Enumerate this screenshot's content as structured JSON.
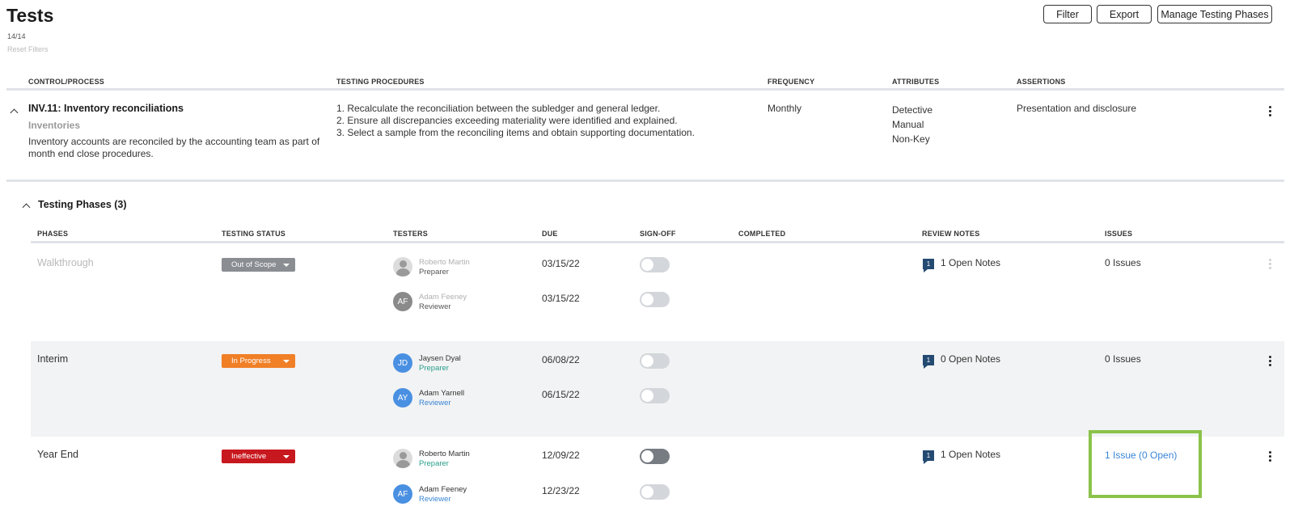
{
  "header": {
    "title": "Tests",
    "count": "14/14",
    "reset_filters": "Reset Filters",
    "buttons": {
      "filter": "Filter",
      "export": "Export",
      "manage": "Manage Testing Phases"
    }
  },
  "control_table": {
    "columns": [
      "CONTROL/PROCESS",
      "TESTING PROCEDURES",
      "FREQUENCY",
      "ATTRIBUTES",
      "ASSERTIONS"
    ],
    "control": {
      "title": "INV.11: Inventory reconciliations",
      "process": "Inventories",
      "description": "Inventory accounts are reconciled by the accounting team as part of month end close procedures.",
      "procedures": [
        "1. Recalculate the reconciliation between the subledger and general ledger.",
        "2. Ensure all discrepancies exceeding materiality were identified and explained.",
        "3. Select a sample from the reconciling items and obtain supporting documentation."
      ],
      "frequency": "Monthly",
      "attributes": [
        "Detective",
        "Manual",
        "Non-Key"
      ],
      "assertions": "Presentation and disclosure"
    }
  },
  "phases": {
    "title": "Testing Phases (3)",
    "columns": [
      "PHASES",
      "TESTING STATUS",
      "TESTERS",
      "DUE",
      "SIGN-OFF",
      "COMPLETED",
      "REVIEW NOTES",
      "ISSUES"
    ],
    "rows": [
      {
        "name": "Walkthrough",
        "status": "Out of Scope",
        "status_color": "#8a8d91",
        "testers": [
          {
            "initials": "",
            "name": "Roberto Martin",
            "role": "Preparer",
            "due": "03/15/22",
            "signed": false
          },
          {
            "initials": "AF",
            "name": "Adam Feeney",
            "role": "Reviewer",
            "due": "03/15/22",
            "signed": false
          }
        ],
        "notes_count": "1",
        "notes": "1 Open Notes",
        "issues": "0 Issues"
      },
      {
        "name": "Interim",
        "status": "In Progress",
        "status_color": "#f07f26",
        "testers": [
          {
            "initials": "JD",
            "name": "Jaysen Dyal",
            "role": "Preparer",
            "due": "06/08/22",
            "signed": false
          },
          {
            "initials": "AY",
            "name": "Adam Yarnell",
            "role": "Reviewer",
            "due": "06/15/22",
            "signed": false
          }
        ],
        "notes_count": "1",
        "notes": "0 Open Notes",
        "issues": "0 Issues"
      },
      {
        "name": "Year End",
        "status": "Ineffective",
        "status_color": "#c8181f",
        "testers": [
          {
            "initials": "",
            "name": "Roberto Martin",
            "role": "Preparer",
            "due": "12/09/22",
            "signed": true
          },
          {
            "initials": "AF",
            "name": "Adam Feeney",
            "role": "Reviewer",
            "due": "12/23/22",
            "signed": false
          }
        ],
        "notes_count": "1",
        "notes": "1 Open Notes",
        "issues": "1 Issue (0 Open)"
      }
    ]
  },
  "colors": {
    "avatar_blue": "#4a90e2",
    "avatar_grey": "#8a8a8a",
    "highlight": "#8bc34a",
    "link": "#3a86d6"
  }
}
